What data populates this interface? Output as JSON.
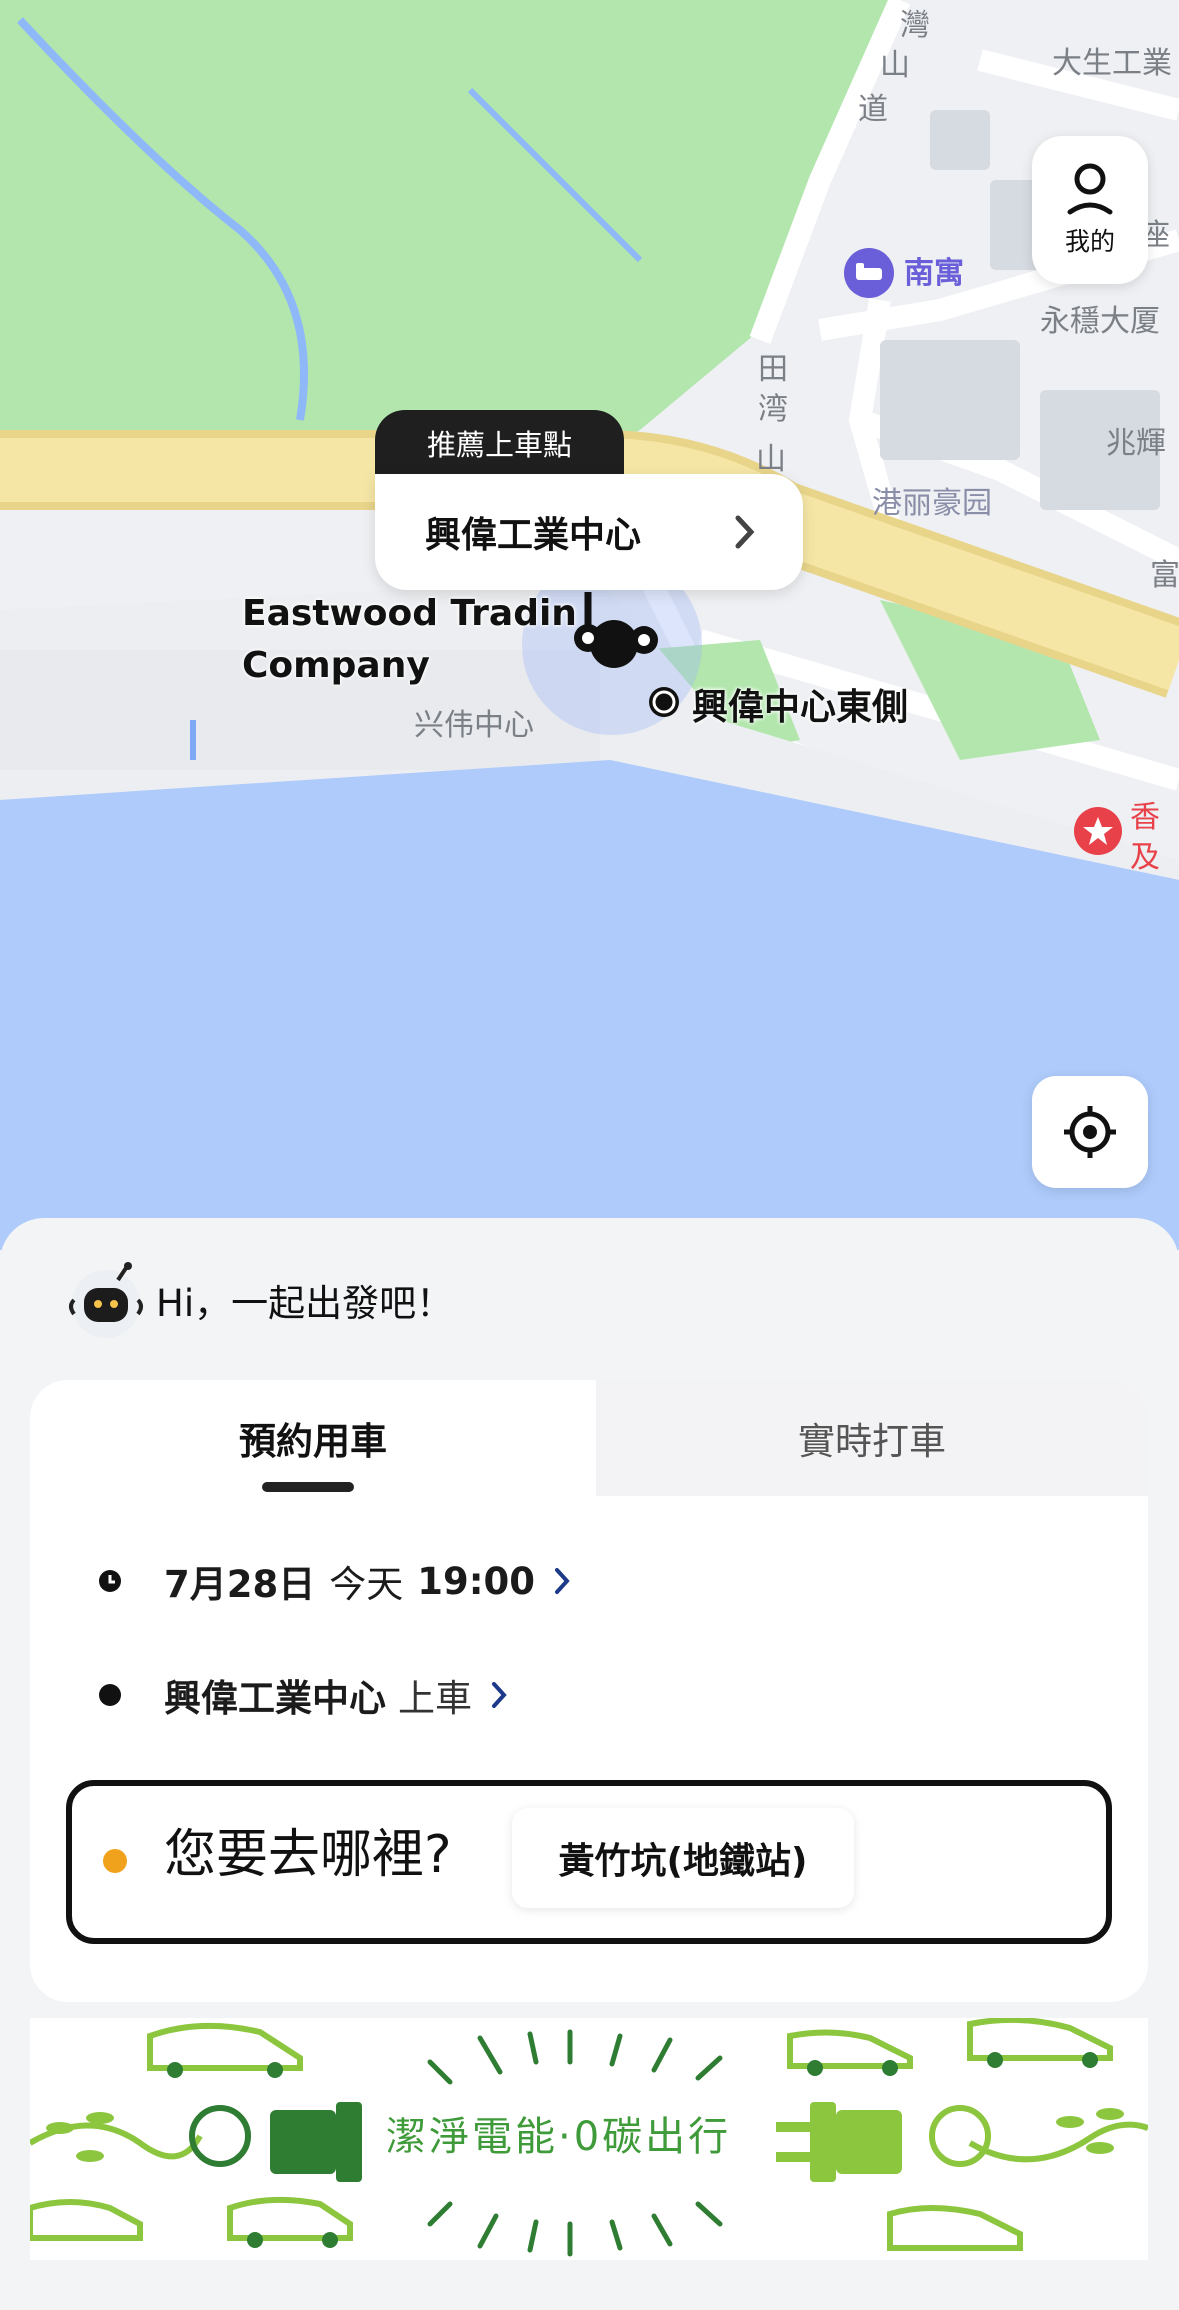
{
  "map": {
    "labels": {
      "dasheng": "大生工業",
      "nanyu": "南寓",
      "wingwan": "永穩大厦",
      "siufai": "兆輝",
      "ganglei": "港丽豪园",
      "xingwei": "兴伟中心",
      "fu": "富",
      "shan_road_1": "灣",
      "shan_road_2": "山",
      "shan_road_3": "道",
      "tin_1": "田",
      "tin_2": "湾",
      "tin_3": "山",
      "zuo": "座",
      "hk_1": "香",
      "hk_2": "及"
    },
    "profile_label": "我的",
    "pickup_tag": "推薦上車點",
    "pickup_name": "興偉工業中心",
    "company_line1": "Eastwood Tradin",
    "company_line2": "Company",
    "east_label": "興偉中心東側"
  },
  "sheet": {
    "greeting": "Hi，一起出發吧！",
    "tabs": {
      "scheduled": "預約用車",
      "instant": "實時打車"
    },
    "time": {
      "date": "7月28日",
      "day": "今天",
      "clock": "19:00"
    },
    "pickup": {
      "place": "興偉工業中心",
      "suffix": "上車"
    },
    "destination": {
      "prompt": "您要去哪裡?",
      "suggestion": "黃竹坑(地鐵站)"
    },
    "banner": {
      "slogan": "潔淨電能·0碳出行"
    }
  },
  "colors": {
    "map_water": "#aecbfb",
    "map_green": "#b2e6ad",
    "map_road_major": "#f6e6a6",
    "dest_dot": "#f0a21c",
    "banner_green": "#3f9a3a",
    "poi_purple": "#6a5fd8",
    "poi_red": "#e8414a"
  }
}
